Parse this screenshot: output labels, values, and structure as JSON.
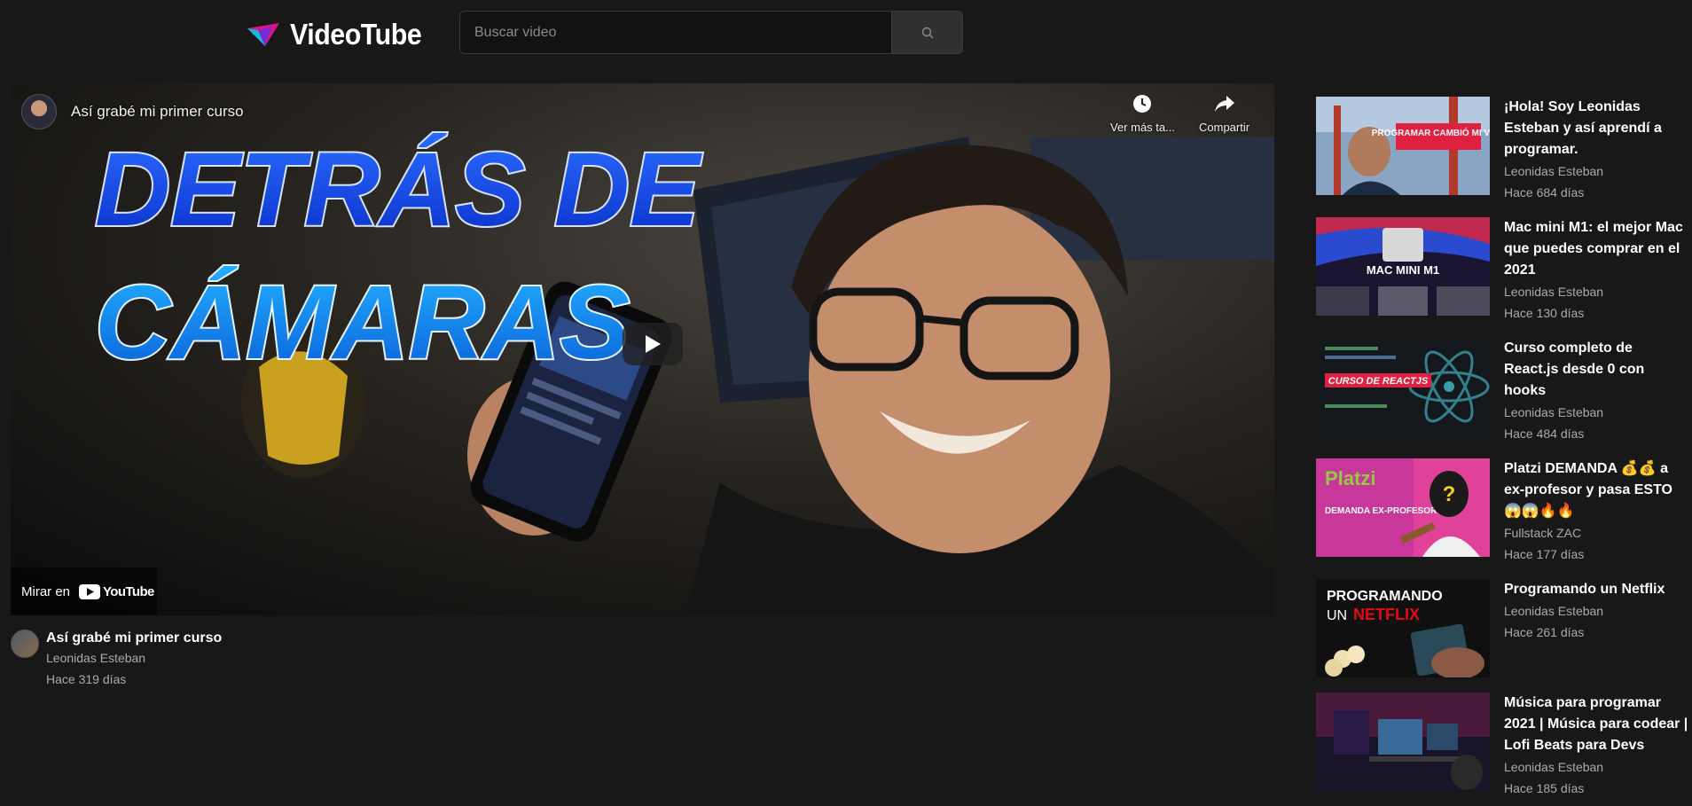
{
  "header": {
    "brand": "VideoTube",
    "search_placeholder": "Buscar video"
  },
  "player": {
    "overlay_title": "Así grabé mi primer curso",
    "thumbnail_headline": [
      "DETRÁS DE",
      "CÁMARAS"
    ],
    "watch_later_label": "Ver más ta...",
    "share_label": "Compartir",
    "watch_on_label": "Mirar en",
    "youtube_label": "YouTube"
  },
  "video": {
    "title": "Así grabé mi primer curso",
    "channel": "Leonidas Esteban",
    "age": "Hace 319 días"
  },
  "recommendations": [
    {
      "title": "¡Hola! Soy Leonidas Esteban y así aprendí a programar.",
      "channel": "Leonidas Esteban",
      "age": "Hace 684 días",
      "thumb_text": "PROGRAMAR CAMBIÓ MI VIDA"
    },
    {
      "title": "Mac mini M1: el mejor Mac que puedes comprar en el 2021",
      "channel": "Leonidas Esteban",
      "age": "Hace 130 días",
      "thumb_text": "MAC MINI M1"
    },
    {
      "title": "Curso completo de React.js desde 0 con hooks",
      "channel": "Leonidas Esteban",
      "age": "Hace 484 días",
      "thumb_text": "CURSO DE REACTJS"
    },
    {
      "title": "Platzi DEMANDA 💰💰 a ex-profesor y pasa ESTO 😱😱🔥🔥",
      "channel": "Fullstack ZAC",
      "age": "Hace 177 días",
      "thumb_text": "DEMANDA EX-PROFESOR"
    },
    {
      "title": "Programando un Netflix",
      "channel": "Leonidas Esteban",
      "age": "Hace 261 días",
      "thumb_text": "PROGRAMANDO UN NETFLIX"
    },
    {
      "title": "Música para programar 2021 | Música para codear | Lofi Beats para Devs",
      "channel": "Leonidas Esteban",
      "age": "Hace 185 días",
      "thumb_text": ""
    }
  ]
}
